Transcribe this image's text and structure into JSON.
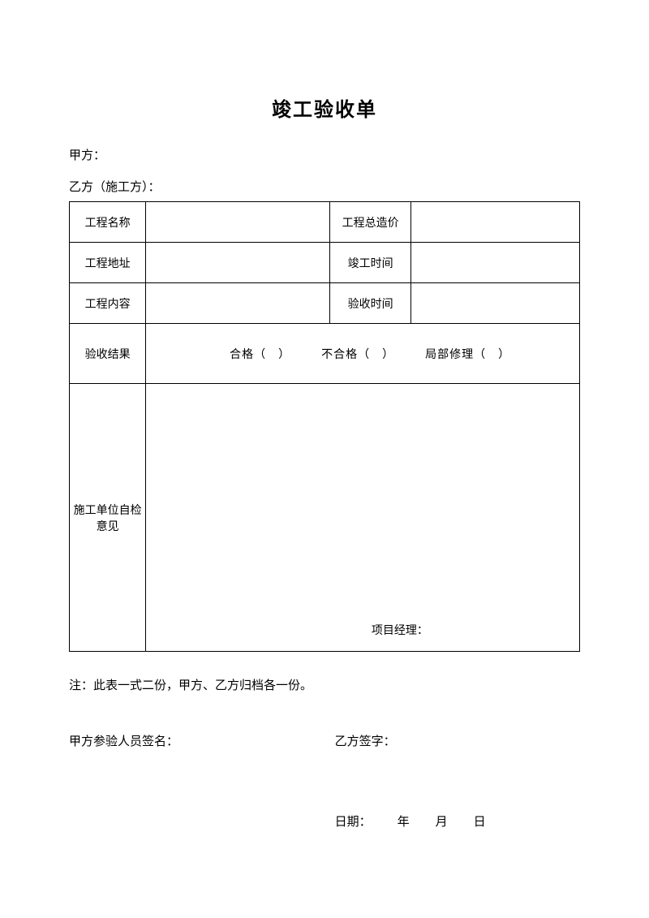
{
  "title": "竣工验收单",
  "party_a": "甲方：",
  "party_b": "乙方（施工方）：",
  "table": {
    "row1_label1": "工程名称",
    "row1_label2": "工程总造价",
    "row2_label1": "工程地址",
    "row2_label2": "竣工时间",
    "row3_label1": "工程内容",
    "row3_label2": "验收时间",
    "row4_label": "验收结果",
    "row4_content": "合格（　）　　　不合格（　）　　　局部修理（　）",
    "row5_label": "施工单位自检意见",
    "pm_label": "项目经理："
  },
  "note": "注：此表一式二份，甲方、乙方归档各一份。",
  "sign_a": "甲方参验人员签名：",
  "sign_b": "乙方签字：",
  "date_label": "日期：",
  "year": "年",
  "month": "月",
  "day": "日"
}
